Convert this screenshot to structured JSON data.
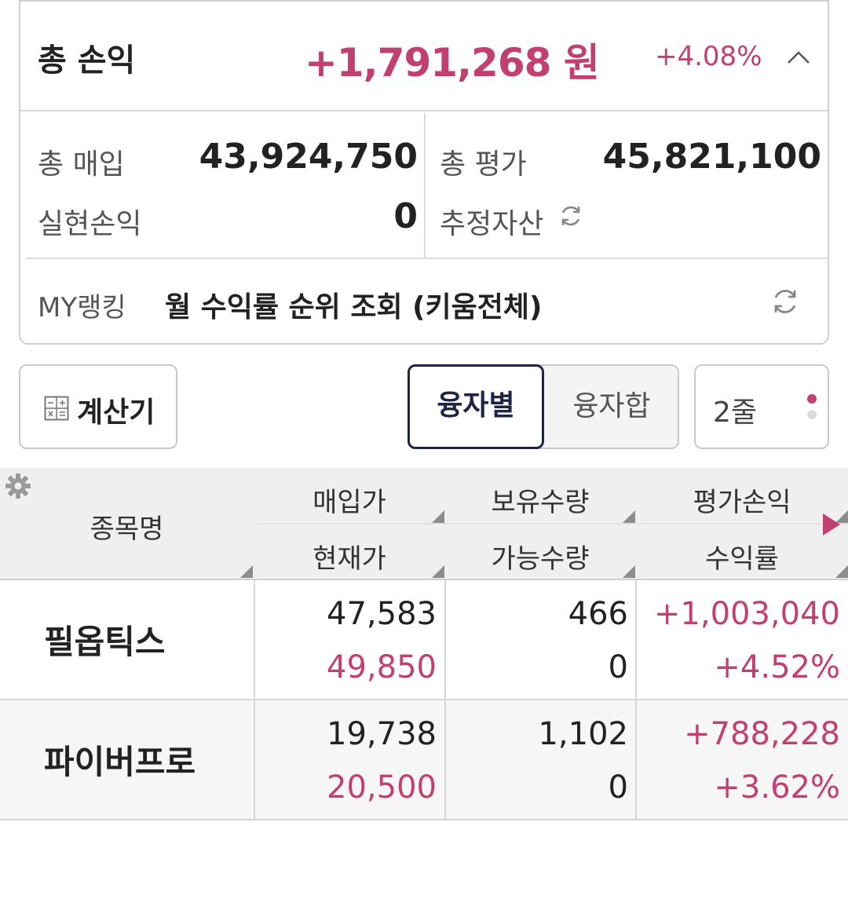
{
  "summary": {
    "total_label": "총 손익",
    "total_amount": "+1,791,268 원",
    "total_pct": "+4.08%",
    "purchase_label": "총 매입",
    "purchase_value": "43,924,750",
    "evaluation_label": "총 평가",
    "evaluation_value": "45,821,100",
    "realized_label": "실현손익",
    "realized_value": "0",
    "estimated_label": "추정자산",
    "ranking_label": "MY랭킹",
    "ranking_text": "월 수익률 순위 조회 (키움전체)"
  },
  "controls": {
    "calculator_label": "계산기",
    "seg_selected": "융자별",
    "seg_other": "융자합",
    "lines_label": "2줄"
  },
  "table": {
    "headers": {
      "name": "종목명",
      "buy_price": "매입가",
      "current_price": "현재가",
      "holding_qty": "보유수량",
      "available_qty": "가능수량",
      "eval_pl": "평가손익",
      "return_rate": "수익률"
    },
    "rows": [
      {
        "name": "필옵틱스",
        "buy_price": "47,583",
        "current_price": "49,850",
        "holding_qty": "466",
        "available_qty": "0",
        "eval_pl": "+1,003,040",
        "return_rate": "+4.52%"
      },
      {
        "name": "파이버프로",
        "buy_price": "19,738",
        "current_price": "20,500",
        "holding_qty": "1,102",
        "available_qty": "0",
        "eval_pl": "+788,228",
        "return_rate": "+3.62%"
      }
    ]
  },
  "colors": {
    "accent": "#c2406f",
    "navy": "#1f2344"
  }
}
